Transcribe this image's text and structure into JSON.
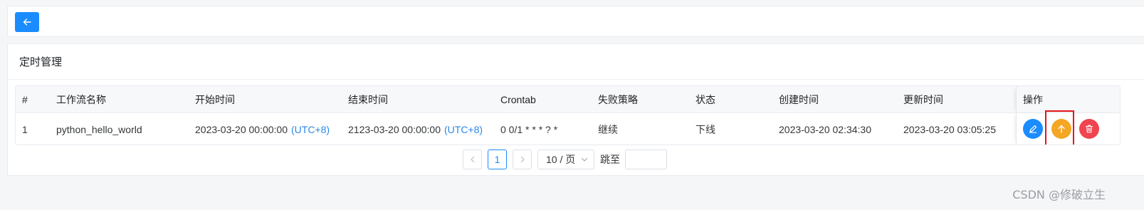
{
  "toolbar": {
    "back_icon": "arrow-left-icon"
  },
  "panel": {
    "title": "定时管理"
  },
  "table": {
    "columns": {
      "index": "#",
      "workflow_name": "工作流名称",
      "start_time": "开始时间",
      "end_time": "结束时间",
      "crontab": "Crontab",
      "failure_strategy": "失败策略",
      "status": "状态",
      "create_time": "创建时间",
      "update_time": "更新时间",
      "actions": "操作"
    },
    "rows": [
      {
        "index": "1",
        "workflow_name": "python_hello_world",
        "start_time": "2023-03-20 00:00:00",
        "start_tz": "(UTC+8)",
        "end_time": "2123-03-20 00:00:00",
        "end_tz": "(UTC+8)",
        "crontab": "0 0/1 * * * ? *",
        "failure_strategy": "继续",
        "status": "下线",
        "create_time": "2023-03-20 02:34:30",
        "update_time": "2023-03-20 03:05:25",
        "actions": [
          "edit-icon",
          "arrow-up-icon",
          "trash-icon"
        ]
      }
    ]
  },
  "pagination": {
    "current_page": "1",
    "page_size": "10 / 页",
    "jump_label": "跳至",
    "jump_value": ""
  },
  "watermark": "CSDN @修破立生",
  "colors": {
    "primary": "#1a8cff",
    "warning": "#f5a623",
    "danger": "#f0454f",
    "highlight": "#e5141c",
    "link": "#2a87e8"
  }
}
